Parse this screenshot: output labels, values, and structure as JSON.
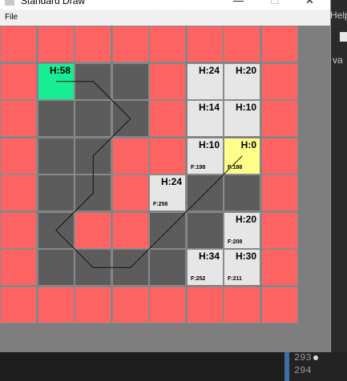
{
  "window": {
    "title": "Standard Draw"
  },
  "menu": {
    "items": [
      "File"
    ]
  },
  "background": {
    "help_label": "Help",
    "side_text": "va",
    "line_numbers": [
      "293",
      "294"
    ]
  },
  "legend_colors": {
    "wall": "#fd6363",
    "open": "#5c5c5c",
    "evaluated": "#e6e6e6",
    "goal": "#ffff8a",
    "start": "#17ee94"
  },
  "grid": {
    "cols": 8,
    "rows": 8,
    "cells": [
      [
        "wall",
        "wall",
        "wall",
        "wall",
        "wall",
        "wall",
        "wall",
        "wall"
      ],
      [
        "wall",
        "start",
        "open",
        "open",
        "wall",
        "info",
        "info",
        "wall"
      ],
      [
        "wall",
        "open",
        "open",
        "open",
        "wall",
        "info",
        "info",
        "wall"
      ],
      [
        "wall",
        "open",
        "open",
        "wall",
        "wall",
        "info",
        "goal",
        "wall"
      ],
      [
        "wall",
        "open",
        "open",
        "wall",
        "info",
        "open",
        "open",
        "wall"
      ],
      [
        "wall",
        "open",
        "wall",
        "wall",
        "open",
        "open",
        "info",
        "wall"
      ],
      [
        "wall",
        "open",
        "open",
        "open",
        "open",
        "info",
        "info",
        "wall"
      ],
      [
        "wall",
        "wall",
        "wall",
        "wall",
        "wall",
        "wall",
        "wall",
        "wall"
      ]
    ],
    "labels": [
      {
        "row": 1,
        "col": 1,
        "h": "H:58",
        "f": ""
      },
      {
        "row": 1,
        "col": 5,
        "h": "H:24",
        "f": ""
      },
      {
        "row": 1,
        "col": 6,
        "h": "H:20",
        "f": ""
      },
      {
        "row": 2,
        "col": 5,
        "h": "H:14",
        "f": ""
      },
      {
        "row": 2,
        "col": 6,
        "h": "H:10",
        "f": ""
      },
      {
        "row": 3,
        "col": 5,
        "h": "H:10",
        "f": "F:198"
      },
      {
        "row": 3,
        "col": 6,
        "h": "H:0",
        "f": "F:188"
      },
      {
        "row": 4,
        "col": 4,
        "h": "H:24",
        "f": "F:258"
      },
      {
        "row": 5,
        "col": 6,
        "h": "H:20",
        "f": "F:208"
      },
      {
        "row": 6,
        "col": 5,
        "h": "H:34",
        "f": "F:252"
      },
      {
        "row": 6,
        "col": 6,
        "h": "H:30",
        "f": "F:211"
      }
    ],
    "path": [
      [
        1.5,
        1.5
      ],
      [
        2.5,
        1.5
      ],
      [
        3.5,
        2.5
      ],
      [
        2.5,
        3.5
      ],
      [
        2.5,
        4.5
      ],
      [
        1.5,
        5.5
      ],
      [
        2.5,
        6.5
      ],
      [
        3.5,
        6.5
      ],
      [
        6.5,
        3.5
      ]
    ]
  }
}
